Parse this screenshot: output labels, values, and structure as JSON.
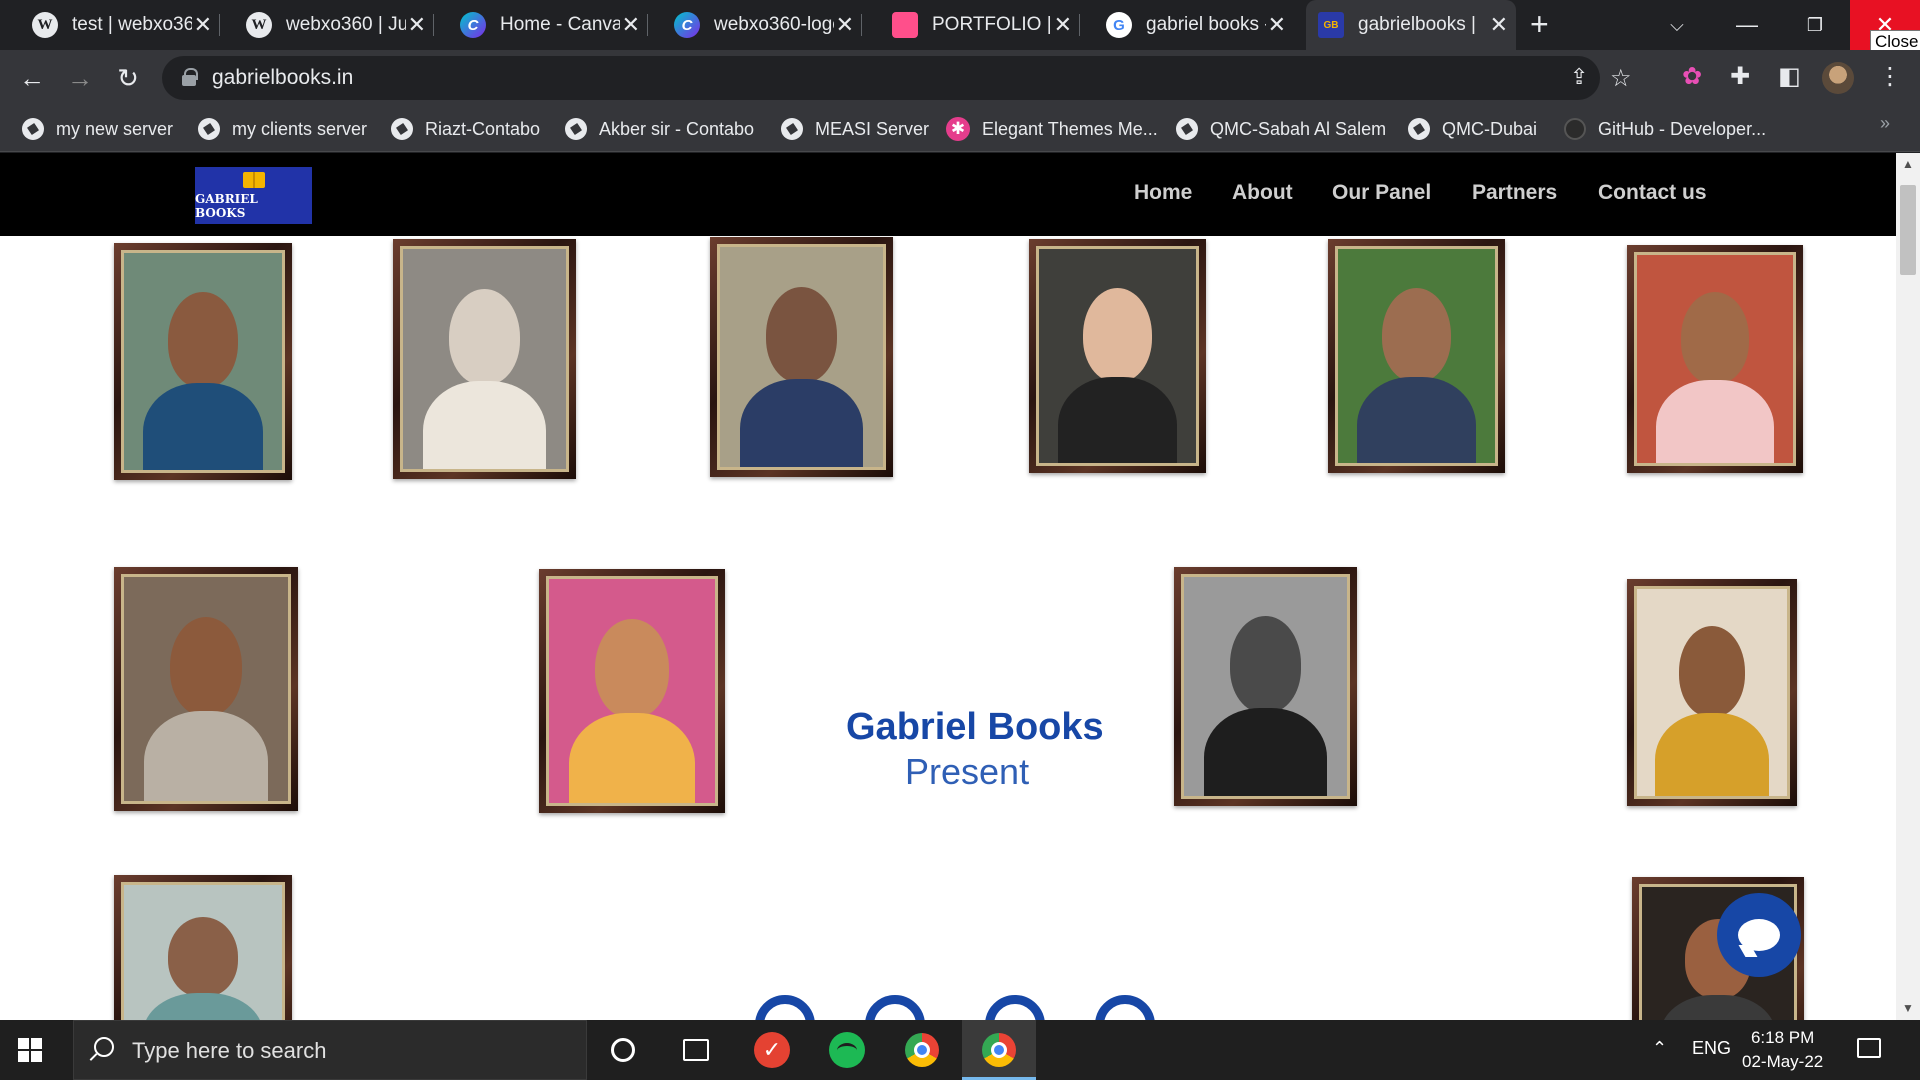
{
  "browser": {
    "tabs": [
      {
        "title": "test | webxo360",
        "icon": "wordpress-icon"
      },
      {
        "title": "webxo360 | Jus",
        "icon": "wordpress-icon"
      },
      {
        "title": "Home - Canva",
        "icon": "canva-icon"
      },
      {
        "title": "webxo360-logo",
        "icon": "canva-icon"
      },
      {
        "title": "PORTFOLIO | W",
        "icon": "portfolio-icon"
      },
      {
        "title": "gabriel books -",
        "icon": "google-icon"
      },
      {
        "title": "gabrielbooks |",
        "icon": "gabriel-books-favicon",
        "active": true
      }
    ],
    "new_tab": "+",
    "close_tooltip": "Close",
    "address": "gabrielbooks.in",
    "bookmarks": [
      {
        "label": "my new server"
      },
      {
        "label": "my clients server"
      },
      {
        "label": "Riazt-Contabo"
      },
      {
        "label": "Akber sir - Contabo"
      },
      {
        "label": "MEASI Server"
      },
      {
        "label": "Elegant Themes Me..."
      },
      {
        "label": "QMC-Sabah Al Salem"
      },
      {
        "label": "QMC-Dubai"
      },
      {
        "label": "GitHub - Developer..."
      }
    ]
  },
  "site": {
    "logo_text": "GABRIEL BOOKS",
    "nav": [
      "Home",
      "About",
      "Our Panel",
      "Partners",
      "Contact us"
    ],
    "headline": "Gabriel Books",
    "subheadline": "Present"
  },
  "taskbar": {
    "search_placeholder": "Type here to search",
    "language": "ENG",
    "time": "6:18 PM",
    "date": "02-May-22"
  },
  "colors": {
    "brand_blue": "#1747a6",
    "logo_bg": "#2133a8",
    "header_bg": "#000000"
  }
}
